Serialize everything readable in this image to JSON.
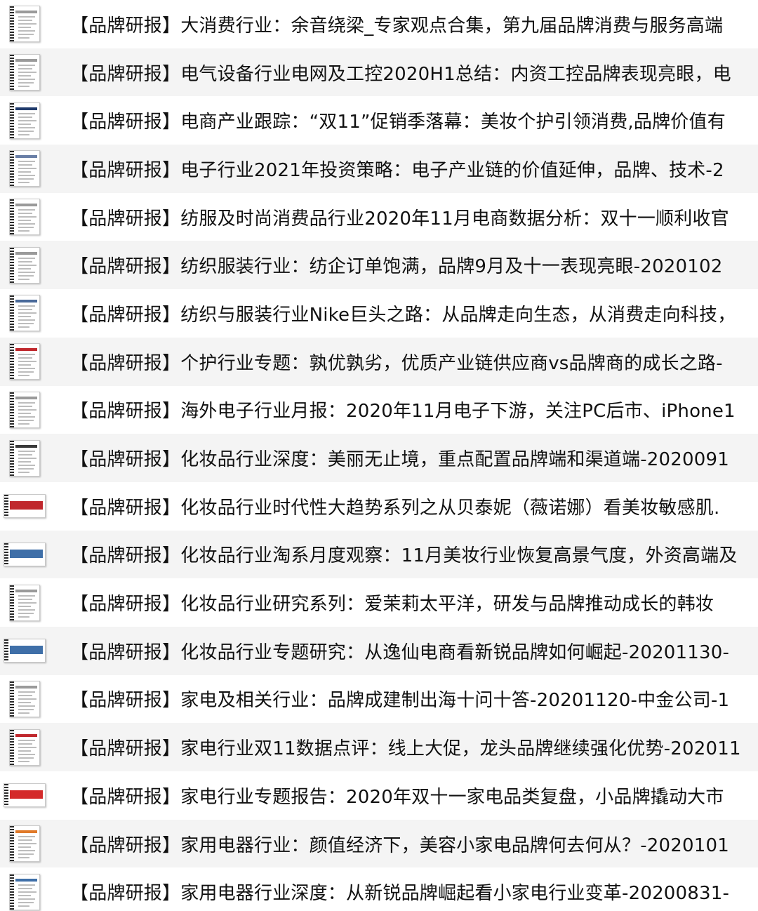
{
  "files": [
    {
      "title": "【品牌研报】大消费行业：余音绕梁_专家观点合集，第九届品牌消费与服务高端",
      "thumb": "doc",
      "accent": "#9a9a9a"
    },
    {
      "title": "【品牌研报】电气设备行业电网及工控2020H1总结：内资工控品牌表现亮眼，电",
      "thumb": "doc",
      "accent": "#9a9a9a"
    },
    {
      "title": "【品牌研报】电商产业跟踪：“双11”促销季落幕：美妆个护引领消费,品牌价值有",
      "thumb": "doc",
      "accent": "#1f3a6b"
    },
    {
      "title": "【品牌研报】电子行业2021年投资策略：电子产业链的价值延伸，品牌、技术-2",
      "thumb": "doc",
      "accent": "#6a7fa6"
    },
    {
      "title": "【品牌研报】纺服及时尚消费品行业2020年11月电商数据分析：双十一顺利收官",
      "thumb": "doc",
      "accent": "#9a9a9a"
    },
    {
      "title": "【品牌研报】纺织服装行业：纺企订单饱满，品牌9月及十一表现亮眼-2020102",
      "thumb": "doc",
      "accent": "#9a9a9a"
    },
    {
      "title": "【品牌研报】纺织与服装行业Nike巨头之路：从品牌走向生态，从消费走向科技，",
      "thumb": "doc",
      "accent": "#4a6a9a"
    },
    {
      "title": "【品牌研报】个护行业专题：孰优孰劣，优质产业链供应商vs品牌商的成长之路-",
      "thumb": "doc",
      "accent": "#c0282d"
    },
    {
      "title": "【品牌研报】海外电子行业月报：2020年11月电子下游，关注PC后市、iPhone1",
      "thumb": "doc",
      "accent": "#9a9a9a"
    },
    {
      "title": "【品牌研报】化妆品行业深度：美丽无止境，重点配置品牌端和渠道端-2020091",
      "thumb": "doc",
      "accent": "#3a3a3a"
    },
    {
      "title": "【品牌研报】化妆品行业时代性大趋势系列之从贝泰妮（薇诺娜）看美妆敏感肌.",
      "thumb": "landscape",
      "accent": "#c0282d"
    },
    {
      "title": "【品牌研报】化妆品行业淘系月度观察：11月美妆行业恢复高景气度，外资高端及",
      "thumb": "landscape",
      "accent": "#3f6fa8"
    },
    {
      "title": "【品牌研报】化妆品行业研究系列：爱茉莉太平洋，研发与品牌推动成长的韩妆",
      "thumb": "doc",
      "accent": "#9a9a9a"
    },
    {
      "title": "【品牌研报】化妆品行业专题研究：从逸仙电商看新锐品牌如何崛起-20201130-",
      "thumb": "landscape",
      "accent": "#3f6fa8"
    },
    {
      "title": "【品牌研报】家电及相关行业：品牌成建制出海十问十答-20201120-中金公司-1",
      "thumb": "doc",
      "accent": "#9a9a9a"
    },
    {
      "title": "【品牌研报】家电行业双11数据点评：线上大促，龙头品牌继续强化优势-202011",
      "thumb": "doc",
      "accent": "#c0282d"
    },
    {
      "title": "【品牌研报】家电行业专题报告：2020年双十一家电品类复盘，小品牌撬动大市",
      "thumb": "landscape",
      "accent": "#d42a2a"
    },
    {
      "title": "【品牌研报】家用电器行业：颜值经济下，美容小家电品牌何去何从？-2020101",
      "thumb": "doc",
      "accent": "#e07a2a"
    },
    {
      "title": "【品牌研报】家用电器行业深度：从新锐品牌崛起看小家电行业变革-20200831-",
      "thumb": "doc",
      "accent": "#3f6fa8"
    }
  ]
}
